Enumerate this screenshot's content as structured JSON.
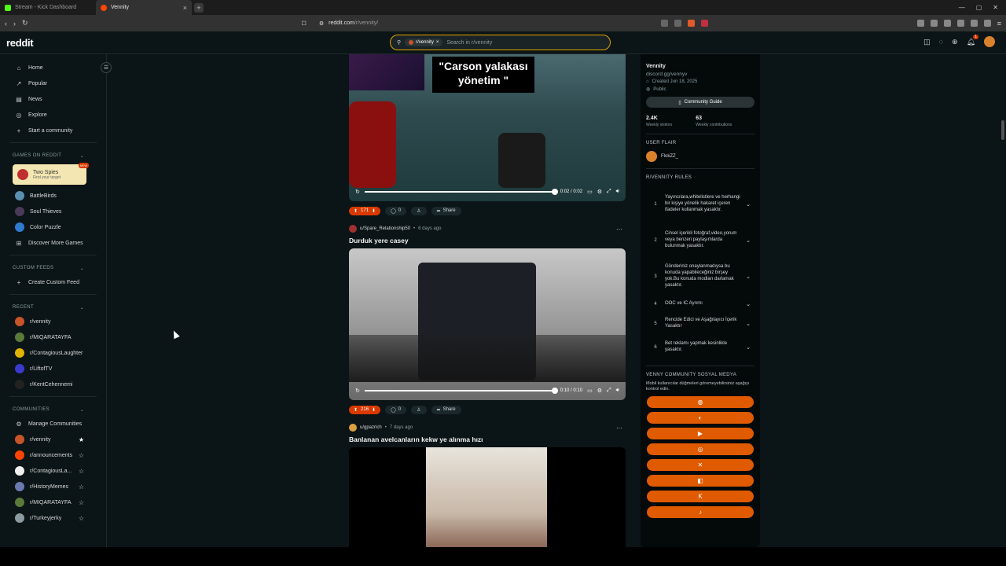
{
  "tabs": [
    {
      "title": "Stream - Kick Dashboard",
      "active": false,
      "color": "#53fc18"
    },
    {
      "title": "Vennity",
      "active": true,
      "color": "#ff4500"
    }
  ],
  "url": {
    "domain": "reddit.com",
    "path": "/r/vennity/"
  },
  "header": {
    "logo": "reddit",
    "search_chip": "r/vennity",
    "search_placeholder": "Search in r/vennity",
    "notif_count": "1"
  },
  "nav": {
    "items": [
      {
        "label": "Home",
        "icon": "⌂",
        "name": "home-icon"
      },
      {
        "label": "Popular",
        "icon": "↗",
        "name": "popular-icon"
      },
      {
        "label": "News",
        "icon": "▤",
        "name": "news-icon"
      },
      {
        "label": "Explore",
        "icon": "◎",
        "name": "explore-icon"
      },
      {
        "label": "Start a community",
        "icon": "+",
        "name": "plus-icon"
      }
    ]
  },
  "games": {
    "heading": "GAMES ON REDDIT",
    "featured": {
      "title": "Two Spies",
      "subtitle": "Find your target",
      "badge": "NEW"
    },
    "items": [
      {
        "label": "BattleBirds",
        "color": "#5b8fb0"
      },
      {
        "label": "Soul Thieves",
        "color": "#4a3a5a"
      },
      {
        "label": "Color Puzzle",
        "color": "#2e7bd0"
      },
      {
        "label": "Discover More Games",
        "color": ""
      }
    ]
  },
  "custom_feeds": {
    "heading": "CUSTOM FEEDS",
    "create": "Create Custom Feed"
  },
  "recent": {
    "heading": "RECENT",
    "items": [
      {
        "label": "r/vennity",
        "color": "#c9542a"
      },
      {
        "label": "r/MIQARATAYFA",
        "color": "#5a7a3a"
      },
      {
        "label": "r/ContagiousLaughter",
        "color": "#e0b300"
      },
      {
        "label": "r/LiftofTV",
        "color": "#3a3ad0"
      },
      {
        "label": "r/KentCehennemi",
        "color": "#222"
      }
    ]
  },
  "communities": {
    "heading": "COMMUNITIES",
    "manage": "Manage Communities",
    "items": [
      {
        "label": "r/vennity",
        "color": "#c9542a",
        "fav": true
      },
      {
        "label": "r/announcements",
        "color": "#ff4500",
        "fav": false
      },
      {
        "label": "r/ContagiousLa...",
        "color": "#f0f0f0",
        "fav": false
      },
      {
        "label": "r/HistoryMemes",
        "color": "#6a7ab0",
        "fav": false
      },
      {
        "label": "r/MIQARATAYFA",
        "color": "#5a7a3a",
        "fav": false
      },
      {
        "label": "r/Turkeyjerky",
        "color": "#8a9aa0",
        "fav": false
      }
    ]
  },
  "posts": [
    {
      "overlay": "\"Carson yalakası\nyönetim \"",
      "time": "0:02 / 0:02",
      "votes": "171",
      "comments": "0",
      "share": "Share",
      "progress": 1.0
    },
    {
      "author": "u/Spare_Relationship50",
      "age": "6 days ago",
      "title": "Durduk yere casey",
      "time": "0:10 / 0:10",
      "votes": "216",
      "comments": "0",
      "share": "Share",
      "progress": 1.0
    },
    {
      "author": "u/gpazrich",
      "age": "7 days ago",
      "title": "Banlanan avelcanların kekw ye alınma hızı"
    }
  ],
  "community": {
    "name": "Vennity",
    "link": "discord.gg/vennyv",
    "created": "Created Jun 18, 2025",
    "visibility": "Public",
    "guide": "Community Guide",
    "visitors": "2.4K",
    "visitors_label": "Weekly visitors",
    "contrib": "63",
    "contrib_label": "Weekly contributions",
    "flair_heading": "USER FLAIR",
    "flair_user": "FlokZZ_",
    "rules_heading": "R/VENNITY RULES",
    "rules": [
      {
        "n": "1",
        "text": "Yayıncılara,whitelistlere ve herhangi bir kişiye yönelik hakaret içeren ifadeler kullanmak yasaktır."
      },
      {
        "n": "2",
        "text": "Cinsel içerikli fotoğraf,video,yorum veya benzeri paylaşımlarda bulunmak yasaktır."
      },
      {
        "n": "3",
        "text": "Gönderiniz onaylanmadıysa bu konuda yapabileceğiniz birşey yok.Bu konuda modları darlamak yasaktır."
      },
      {
        "n": "4",
        "text": "OOC ve IC Ayrımı"
      },
      {
        "n": "5",
        "text": "Rencide Edici ve Aşağılayıcı İçerik Yasaktır"
      },
      {
        "n": "6",
        "text": "Bet reklamı yapmak kesinlikle yasaktır."
      }
    ],
    "social_heading": "VENNY COMMUNITY SOSYAL MEDYA",
    "social_note": "Mobil kullanıcılar düğmeleri göremeyebilirsiniz aşağıyı kontrol edin.",
    "social": [
      {
        "icon": "◍",
        "name": "website-icon"
      },
      {
        "icon": "◐",
        "name": "discord-icon"
      },
      {
        "icon": "▶",
        "name": "youtube-icon"
      },
      {
        "icon": "◎",
        "name": "instagram-icon"
      },
      {
        "icon": "✕",
        "name": "x-icon"
      },
      {
        "icon": "◧",
        "name": "twitch-icon"
      },
      {
        "icon": "K",
        "name": "kick-icon"
      },
      {
        "icon": "♪",
        "name": "tiktok-icon"
      }
    ]
  }
}
